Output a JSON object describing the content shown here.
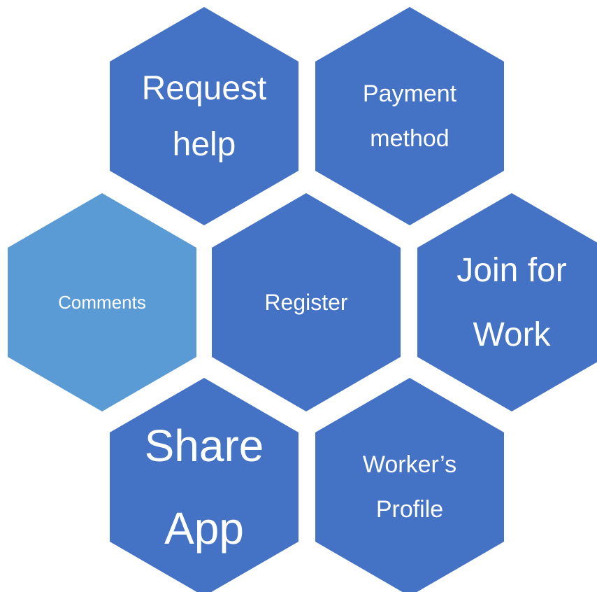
{
  "colors": {
    "primary": "#4472C4",
    "accent": "#5B9BD5",
    "text": "#FFFFFF",
    "background": "#FFFFFF"
  },
  "hexagons": [
    {
      "id": "request-help",
      "lines": [
        "Request",
        "help"
      ],
      "color": "#4472C4"
    },
    {
      "id": "payment-method",
      "lines": [
        "Payment",
        "method"
      ],
      "color": "#4472C4"
    },
    {
      "id": "comments",
      "lines": [
        "Comments"
      ],
      "color": "#5B9BD5"
    },
    {
      "id": "register",
      "lines": [
        "Register"
      ],
      "color": "#4472C4"
    },
    {
      "id": "join-for-work",
      "lines": [
        "Join for",
        "Work"
      ],
      "color": "#4472C4"
    },
    {
      "id": "share-app",
      "lines": [
        "Share",
        "App"
      ],
      "color": "#4472C4"
    },
    {
      "id": "workers-profile",
      "lines": [
        "Worker’s",
        "Profile"
      ],
      "color": "#4472C4"
    }
  ]
}
